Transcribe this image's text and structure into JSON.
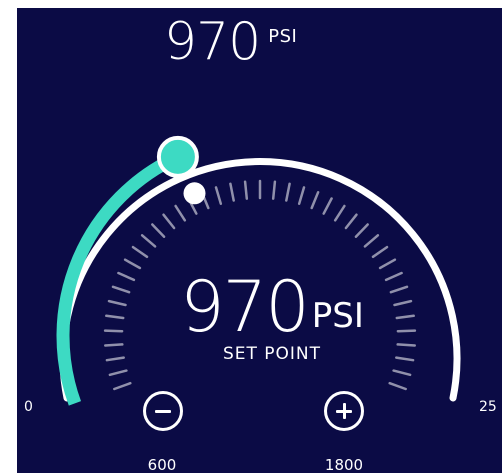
{
  "gauge": {
    "current_value": "970",
    "current_unit": "PSI",
    "setpoint_value": "970",
    "setpoint_unit": "PSI",
    "setpoint_label": "SET POINT",
    "range_min_label": "0",
    "range_max_label": "25",
    "level_fraction": 0.388,
    "setpoint_fraction": 0.388
  },
  "controls": {
    "decrease_label": "600",
    "increase_label": "1800"
  },
  "colors": {
    "background": "#0b0b45",
    "accent": "#3ddac3",
    "track": "#ffffff"
  },
  "icons": {
    "decrease": "minus-circle-icon",
    "increase": "plus-circle-icon"
  }
}
